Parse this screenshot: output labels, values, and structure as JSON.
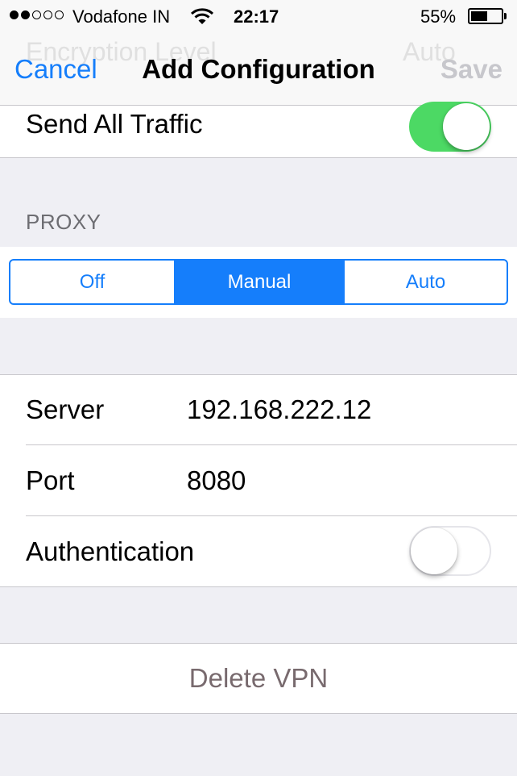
{
  "status_bar": {
    "signal_dots_filled": 2,
    "signal_dots_total": 5,
    "carrier": "Vodafone IN",
    "time": "22:17",
    "battery_percent": "55%",
    "battery_level": 0.55,
    "wifi_icon": "wifi-icon"
  },
  "nav": {
    "ghost_left": "Encryption Level",
    "ghost_right": "Auto",
    "cancel_label": "Cancel",
    "title": "Add Configuration",
    "save_label": "Save"
  },
  "send_all_traffic": {
    "label": "Send All Traffic",
    "enabled": true
  },
  "proxy": {
    "header": "PROXY",
    "options": [
      "Off",
      "Manual",
      "Auto"
    ],
    "selected": "Manual"
  },
  "fields": {
    "server_label": "Server",
    "server_value": "192.168.222.12",
    "port_label": "Port",
    "port_value": "8080",
    "authentication_label": "Authentication",
    "authentication_enabled": false
  },
  "delete_label": "Delete VPN",
  "colors": {
    "accent": "#157efb",
    "switch_on": "#4cd964",
    "background": "#efeff4"
  }
}
